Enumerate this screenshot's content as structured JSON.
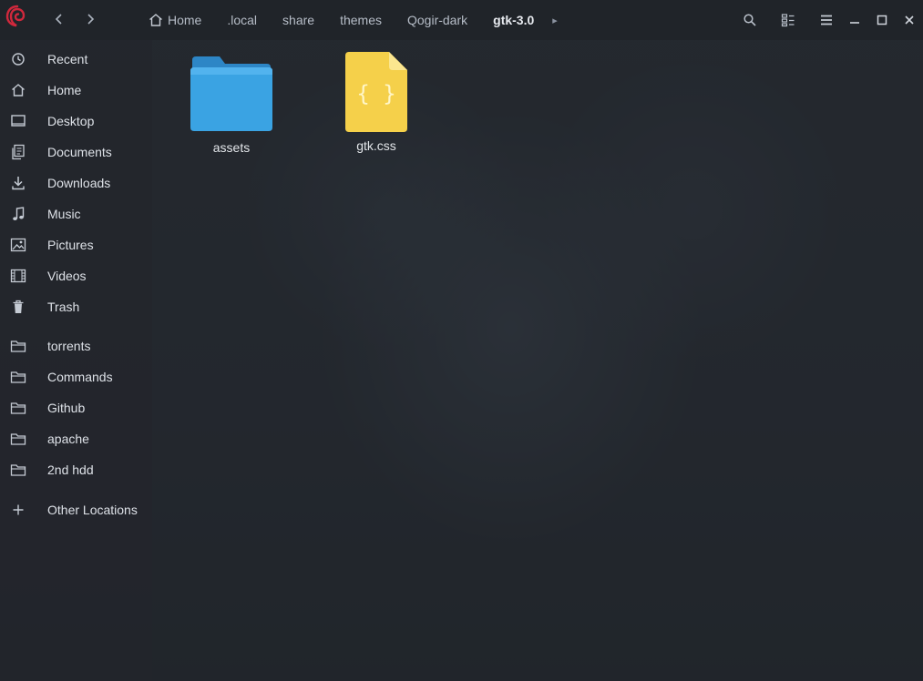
{
  "window": {
    "colors": {
      "accent": "#d0283c",
      "folder": "#3aa3e3",
      "css_file": "#f5d04a"
    }
  },
  "headerbar": {
    "path": [
      {
        "label": "Home",
        "icon": "home-icon"
      },
      {
        "label": ".local"
      },
      {
        "label": "share"
      },
      {
        "label": "themes"
      },
      {
        "label": "Qogir-dark"
      },
      {
        "label": "gtk-3.0",
        "current": true
      }
    ]
  },
  "sidebar": {
    "places": [
      {
        "label": "Recent",
        "icon": "recent-icon"
      },
      {
        "label": "Home",
        "icon": "home-icon"
      },
      {
        "label": "Desktop",
        "icon": "desktop-icon"
      },
      {
        "label": "Documents",
        "icon": "documents-icon"
      },
      {
        "label": "Downloads",
        "icon": "downloads-icon"
      },
      {
        "label": "Music",
        "icon": "music-icon"
      },
      {
        "label": "Pictures",
        "icon": "pictures-icon"
      },
      {
        "label": "Videos",
        "icon": "videos-icon"
      },
      {
        "label": "Trash",
        "icon": "trash-icon"
      }
    ],
    "bookmarks": [
      {
        "label": "torrents",
        "icon": "folder-icon"
      },
      {
        "label": "Commands",
        "icon": "folder-icon"
      },
      {
        "label": "Github",
        "icon": "folder-icon"
      },
      {
        "label": "apache",
        "icon": "folder-icon"
      },
      {
        "label": "2nd hdd",
        "icon": "folder-icon"
      }
    ],
    "other": {
      "label": "Other Locations",
      "icon": "plus-icon"
    }
  },
  "files": [
    {
      "name": "assets",
      "type": "folder",
      "icon": "folder-icon"
    },
    {
      "name": "gtk.css",
      "type": "css",
      "icon": "css-file-icon"
    }
  ]
}
